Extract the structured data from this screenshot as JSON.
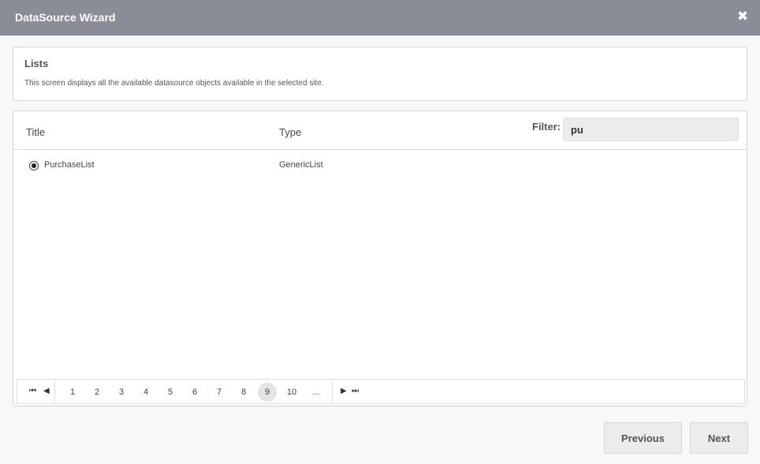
{
  "window": {
    "title": "DataSource Wizard",
    "close_glyph": "✖",
    "titlebar_color": "#8a8d97"
  },
  "info": {
    "heading": "Lists",
    "description": "This screen displays all the available datasource objects available in the selected site."
  },
  "grid": {
    "columns": {
      "title": "Title",
      "type": "Type"
    },
    "filter": {
      "label": "Filter:",
      "value": "pu"
    },
    "rows": [
      {
        "selected": true,
        "title": "PurchaseList",
        "type": "GenericList"
      }
    ]
  },
  "pager": {
    "first_glyph": "⏮",
    "prev_glyph": "◀",
    "next_glyph": "▶",
    "last_glyph": "⏭",
    "pages": [
      "1",
      "2",
      "3",
      "4",
      "5",
      "6",
      "7",
      "8",
      "9",
      "10",
      "..."
    ],
    "current_page": "9"
  },
  "footer": {
    "previous_label": "Previous",
    "next_label": "Next"
  }
}
